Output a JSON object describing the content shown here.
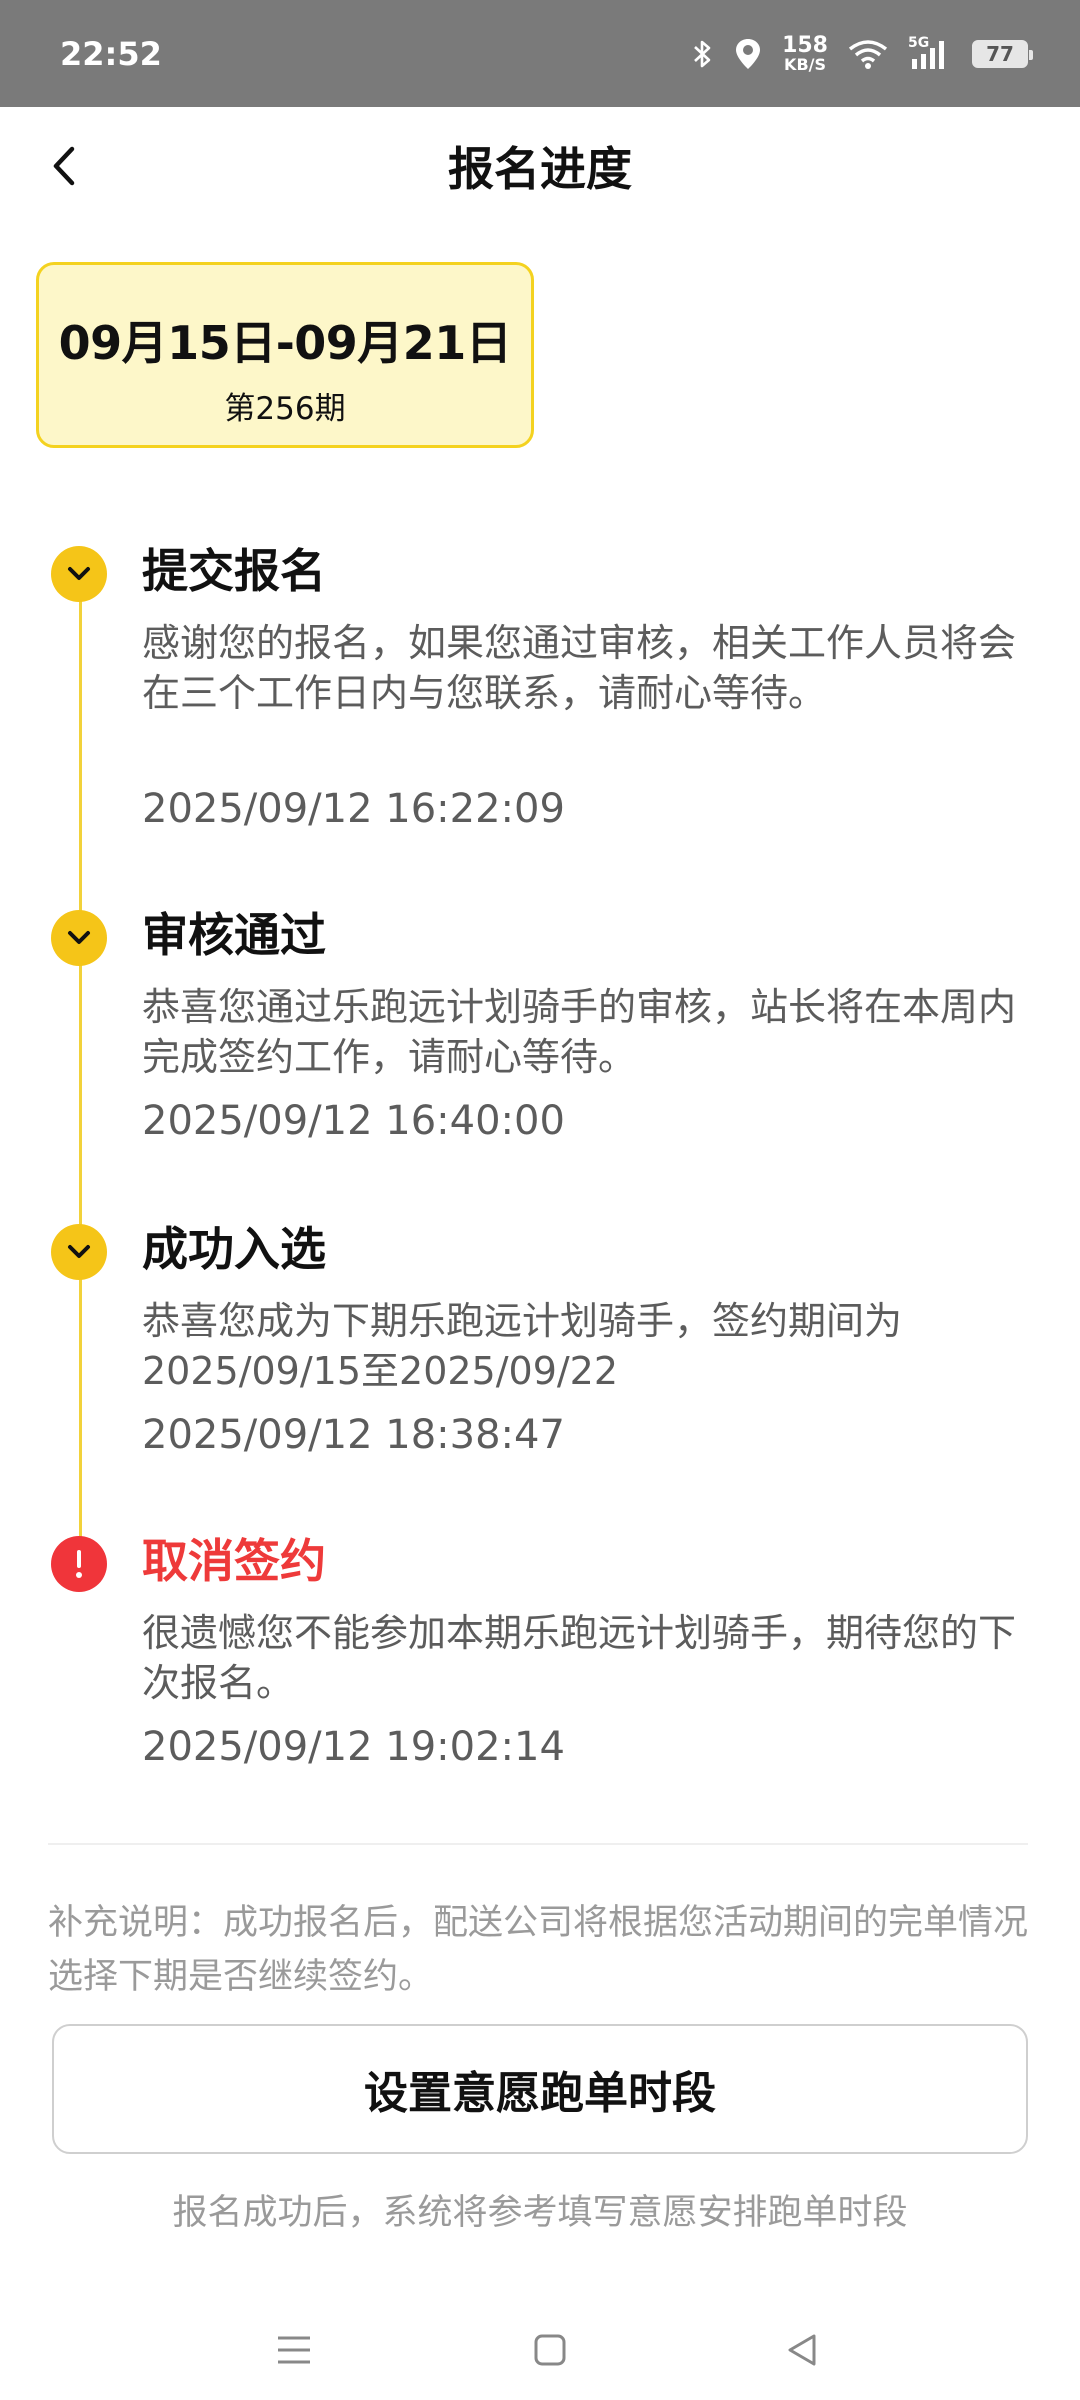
{
  "status_bar": {
    "time": "22:52",
    "net_speed_value": "158",
    "net_speed_unit": "KB/S",
    "network_type": "5G",
    "battery": "77",
    "icons": [
      "bluetooth-icon",
      "location-icon",
      "wifi-icon",
      "signal-icon",
      "battery-icon"
    ]
  },
  "header": {
    "title": "报名进度",
    "back_icon": "chevron-left-icon"
  },
  "period": {
    "dates": "09月15日-09月21日",
    "issue": "第256期"
  },
  "timeline": {
    "steps": [
      {
        "status": "done",
        "icon": "chevron-down-icon",
        "title": "提交报名",
        "desc": "感谢您的报名，如果您通过审核，相关工作人员将会在三个工作日内与您联系，请耐心等待。",
        "time": "2025/09/12 16:22:09"
      },
      {
        "status": "done",
        "icon": "chevron-down-icon",
        "title": "审核通过",
        "desc": "恭喜您通过乐跑远计划骑手的审核，站长将在本周内完成签约工作，请耐心等待。",
        "time": "2025/09/12 16:40:00"
      },
      {
        "status": "done",
        "icon": "chevron-down-icon",
        "title": "成功入选",
        "desc": "恭喜您成为下期乐跑远计划骑手，签约期间为2025/09/15至2025/09/22",
        "time": "2025/09/12 18:38:47"
      },
      {
        "status": "error",
        "icon": "exclamation-icon",
        "title": "取消签约",
        "desc": "很遗憾您不能参加本期乐跑远计划骑手，期待您的下次报名。",
        "time": "2025/09/12 19:02:14"
      }
    ],
    "colors": {
      "line": "#f2d23a",
      "done": "#f5c518",
      "error": "#f0353a"
    }
  },
  "note": "补充说明：成功报名后，配送公司将根据您活动期间的完单情况选择下期是否继续签约。",
  "action": {
    "button_label": "设置意愿跑单时段",
    "hint": "报名成功后，系统将参考填写意愿安排跑单时段"
  },
  "nav_bar": {
    "icons": [
      "menu-icon",
      "home-square-icon",
      "back-triangle-icon"
    ]
  }
}
